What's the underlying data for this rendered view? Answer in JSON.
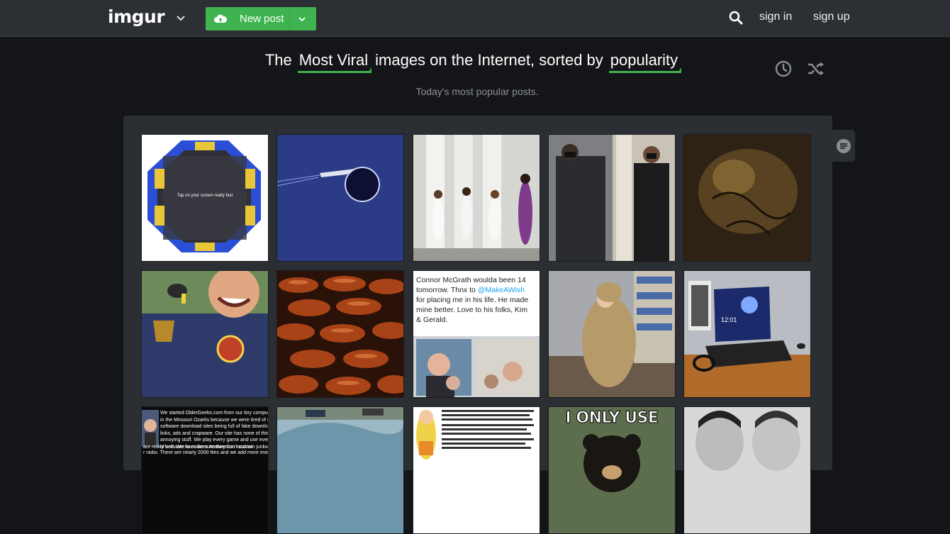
{
  "header": {
    "logo_text": "imgur",
    "new_post_label": "New post",
    "sign_in_label": "sign in",
    "sign_up_label": "sign up",
    "icons": [
      "logo-caret-icon",
      "cloud-upload-icon",
      "chevron-down-icon",
      "search-icon"
    ]
  },
  "headline": {
    "prefix": "The",
    "section": "Most Viral",
    "middle": "images on the Internet, sorted by",
    "sort": "popularity",
    "subtitle": "Today's most popular posts."
  },
  "tools": [
    "clock-icon",
    "shuffle-icon"
  ],
  "side_tab_icon": "comments-icon",
  "colors": {
    "accent": "#3fb34f",
    "topbar": "#2c2f34",
    "page": "#141518",
    "gallery": "#2b2e33"
  },
  "thumb_texts": {
    "tramp": "Tap on your screen really fast",
    "tweet_line1": "Connor McGrath woulda been 14",
    "tweet_line2": "tomorrow. Thnx to",
    "tweet_handle": "@MakeAWish",
    "tweet_line3": "for placing me in his life. He made",
    "tweet_line4": "mine better. Love to his folks, Kim",
    "tweet_line5": "& Gerald.",
    "laptop_time": "12:01",
    "meme": "I ONLY USE",
    "older_1": "We started OlderGeeks.com from our tiny comput",
    "older_2": "in the Missouri Ozarks because we were tired of n",
    "older_3": "software download sites being full of fake downlo",
    "older_4": "links, ads and crapware. Our site has none of this",
    "older_5": "annoying stuff. We play every game and use even",
    "older_6": "of software to make sure they don't contain junkw",
    "older_7": "are really free. We have been featured on local ne",
    "older_8": "r radio. There are nearly 2000 files and we add more every"
  }
}
